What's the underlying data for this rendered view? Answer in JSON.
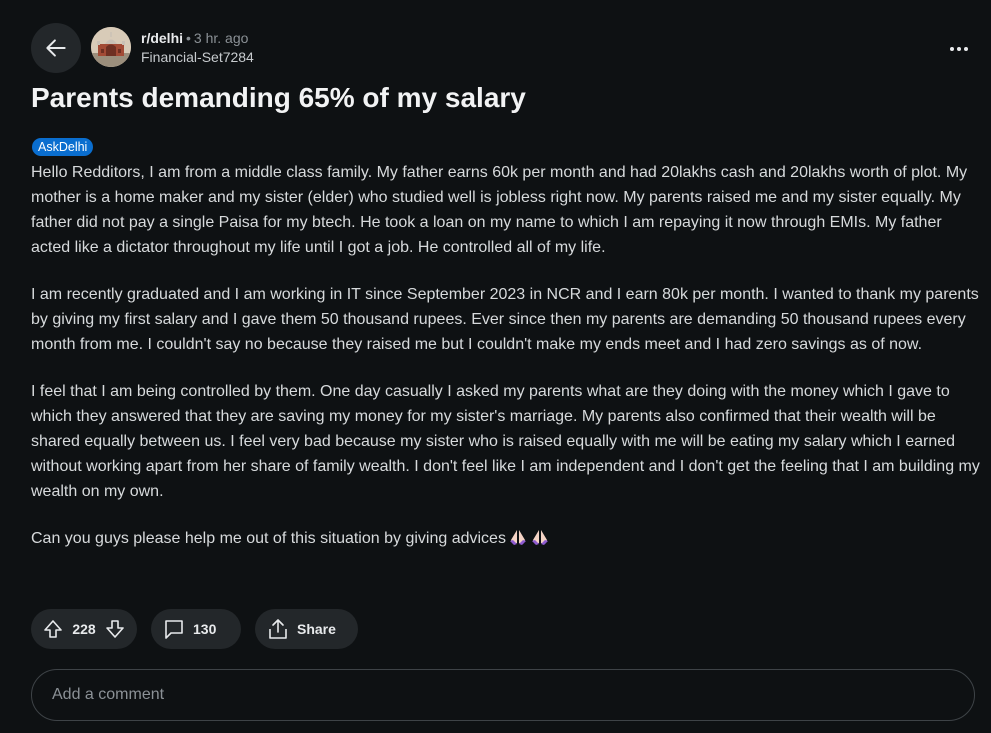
{
  "post": {
    "subreddit": "r/delhi",
    "separator": "•",
    "time": "3 hr. ago",
    "author": "Financial-Set7284",
    "title": "Parents demanding 65% of my salary",
    "flair": "AskDelhi",
    "paragraphs": [
      "Hello Redditors, I am from a middle class family. My father earns 60k per month and had 20lakhs cash and 20lakhs worth of plot. My mother is a home maker and my sister (elder) who studied well is jobless right now. My parents raised me and my sister equally. My father did not pay a single Paisa for my btech. He took a loan on my name to which I am repaying it now through EMIs. My father acted like a dictator throughout my life until I got a job. He controlled all of my life.",
      "I am recently graduated and I am working in IT since September 2023 in NCR and I earn 80k per month. I wanted to thank my parents by giving my first salary and I gave them 50 thousand rupees. Ever since then my parents are demanding 50 thousand rupees every month from me. I couldn't say no because they raised me but I couldn't make my ends meet and I had zero savings as of now.",
      "I feel that I am being controlled by them. One day casually I asked my parents what are they doing with the money which I gave to which they answered that they are saving my money for my sister's marriage. My parents also confirmed that their wealth will be shared equally between us. I feel very bad because my sister who is raised equally with me will be eating my salary which I earned without working apart from her share of family wealth. I don't feel like I am independent and I don't get the feeling that I am building my wealth on my own.",
      "Can you guys please help me out of this situation by giving advices"
    ]
  },
  "actions": {
    "votes": "228",
    "comments": "130",
    "share_label": "Share"
  },
  "comment_box": {
    "placeholder": "Add a comment"
  },
  "icons": {
    "back": "arrow-left-icon",
    "more": "more-horizontal-icon",
    "upvote": "upvote-arrow-icon",
    "downvote": "downvote-arrow-icon",
    "comment": "comment-bubble-icon",
    "share": "share-icon",
    "emoji": "folded-hands-emoji"
  },
  "colors": {
    "background": "#0e1113",
    "button_bg": "#23272a",
    "flair_bg": "#0a6ecf",
    "text": "#d7dadc",
    "muted": "#8b9196"
  }
}
